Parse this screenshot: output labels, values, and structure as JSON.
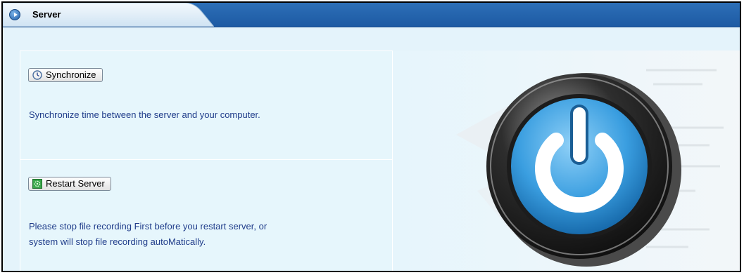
{
  "header": {
    "title": "Server"
  },
  "synchronize": {
    "button_label": "Synchronize",
    "description": "Synchronize time between the server and your computer."
  },
  "restart": {
    "button_label": "Restart Server",
    "description_line1": "Please stop file recording First before you restart server, or",
    "description_line2": "system will stop file recording autoMatically."
  },
  "icons": {
    "header": "circle-arrow-icon",
    "synchronize": "clock-icon",
    "restart": "restart-icon",
    "illustration": "power-icon"
  },
  "colors": {
    "header_blue": "#2d6fb7",
    "tab_light": "#dcecf8",
    "text_blue": "#1f3c8a",
    "panel_bg": "#e4f3fb"
  }
}
